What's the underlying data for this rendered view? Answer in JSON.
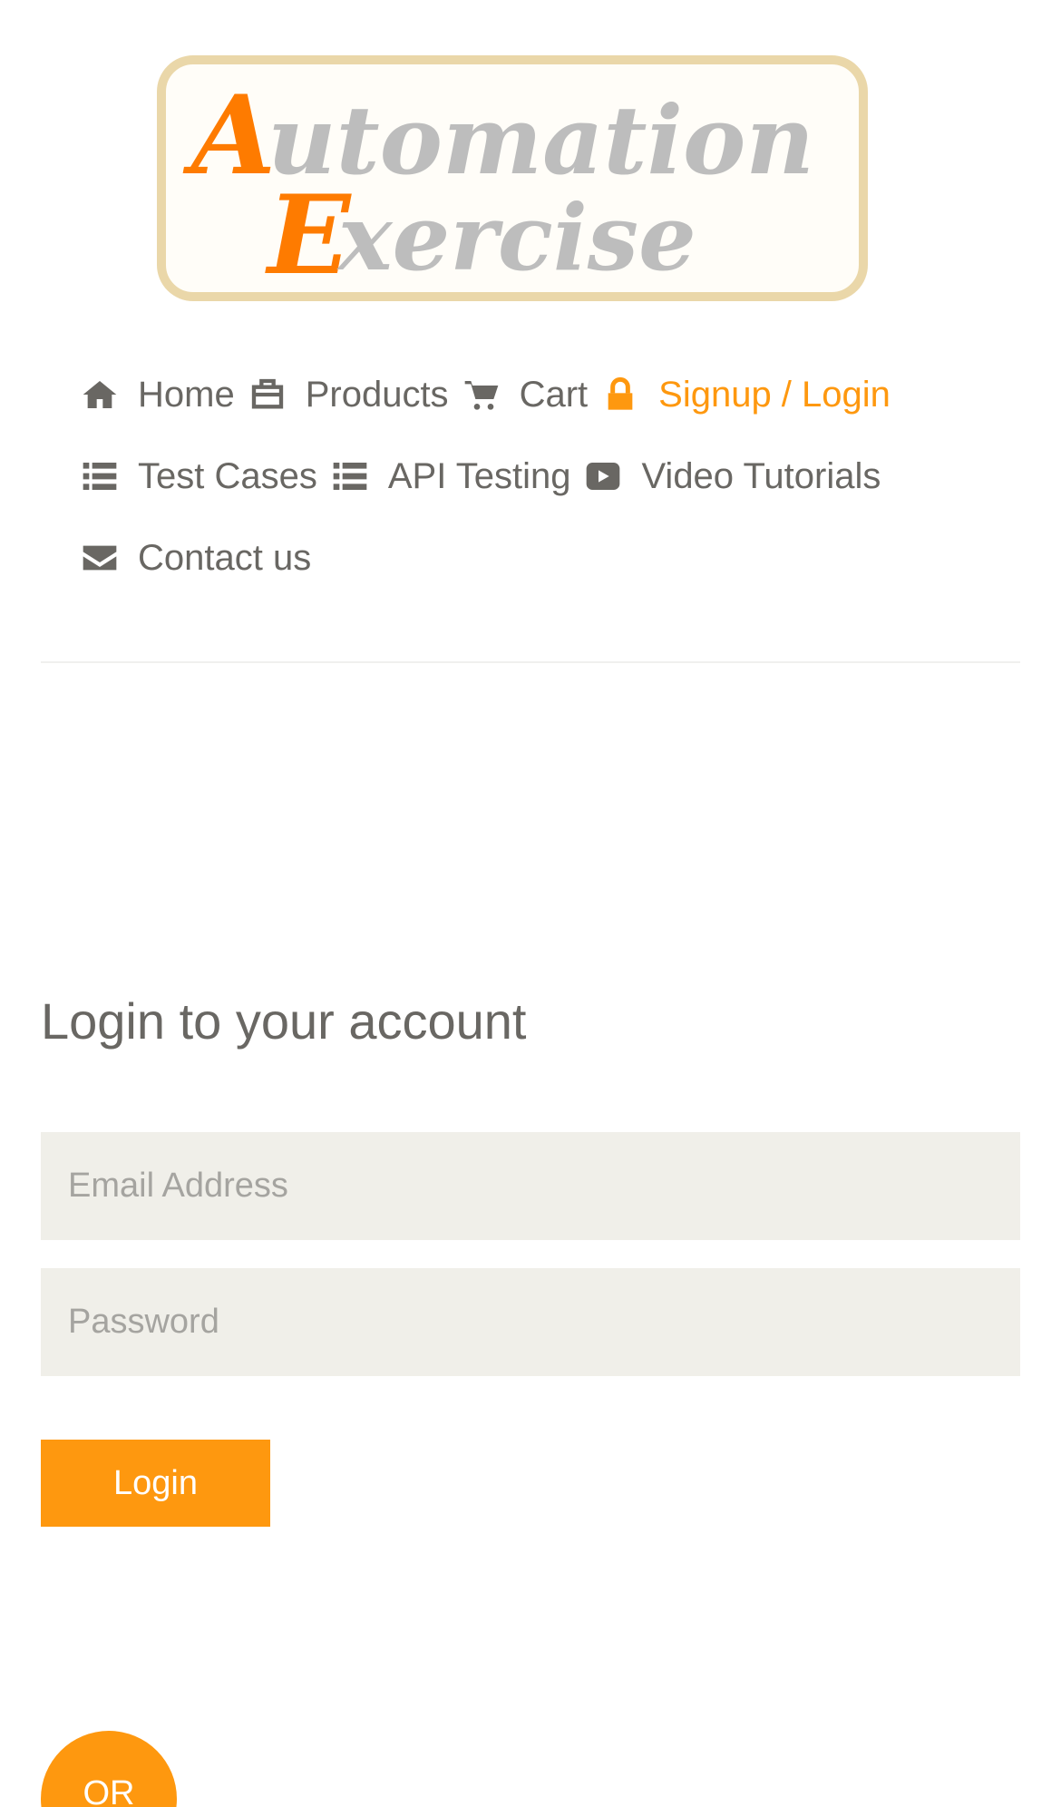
{
  "logo": {
    "alt": "Automation Exercise",
    "line1_first": "A",
    "line1_rest": "utomation",
    "line2_first": "E",
    "line2_rest": "xercise"
  },
  "nav": {
    "items": [
      {
        "label": "Home",
        "icon": "home-icon"
      },
      {
        "label": "Products",
        "icon": "briefcase-icon"
      },
      {
        "label": "Cart",
        "icon": "cart-icon"
      },
      {
        "label": "Signup / Login",
        "icon": "lock-icon",
        "active": true
      },
      {
        "label": "Test Cases",
        "icon": "list-icon"
      },
      {
        "label": "API Testing",
        "icon": "list-icon"
      },
      {
        "label": "Video Tutorials",
        "icon": "youtube-play-icon"
      },
      {
        "label": "Contact us",
        "icon": "envelope-icon"
      }
    ]
  },
  "login": {
    "title": "Login to your account",
    "email_placeholder": "Email Address",
    "password_placeholder": "Password",
    "button_label": "Login"
  },
  "or_label": "OR",
  "colors": {
    "accent": "#fe980f",
    "text": "#696763",
    "input_bg": "#f0efe9"
  }
}
